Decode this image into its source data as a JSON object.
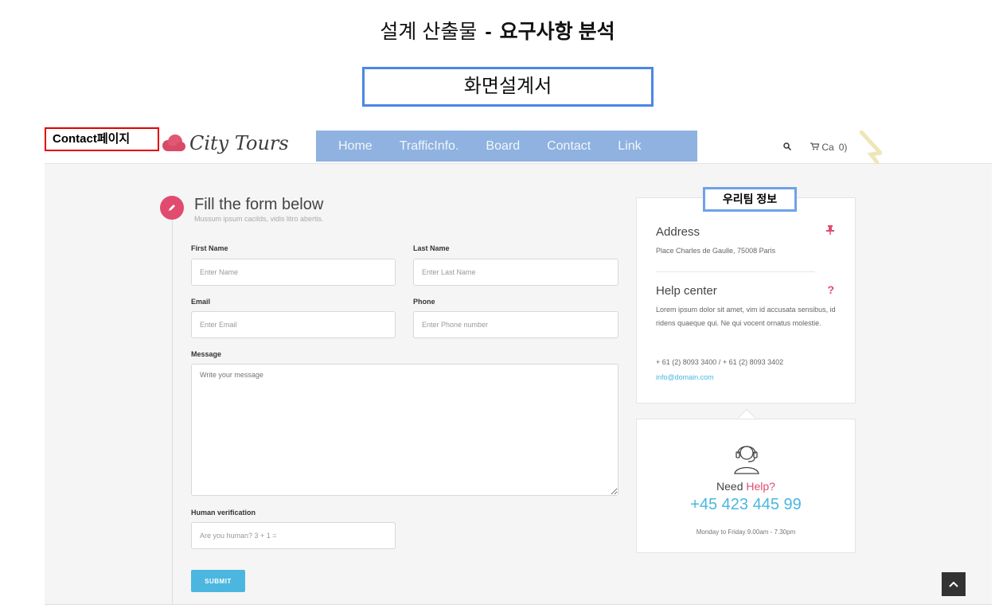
{
  "doc": {
    "title_part1": "설계 산출물",
    "title_sep": "-",
    "title_part2": "요구사항 분석",
    "subtitle": "화면설계서",
    "page_label": "Contact페이지",
    "team_label": "우리팀 정보"
  },
  "header": {
    "logo_text": "City Tours",
    "nav": [
      "Home",
      "TrafficInfo.",
      "Board",
      "Contact",
      "Link"
    ],
    "cart_label": "Ca",
    "cart_count": "0)"
  },
  "form": {
    "title": "Fill the form below",
    "subtitle": "Mussum ipsum cacilds, vidis litro abertis.",
    "first_name_label": "First Name",
    "first_name_placeholder": "Enter Name",
    "last_name_label": "Last Name",
    "last_name_placeholder": "Enter Last Name",
    "email_label": "Email",
    "email_placeholder": "Enter Email",
    "phone_label": "Phone",
    "phone_placeholder": "Enter Phone number",
    "message_label": "Message",
    "message_placeholder": "Write your message",
    "verification_label": "Human verification",
    "verification_placeholder": "Are you human? 3 + 1 =",
    "submit_label": "SUBMIT"
  },
  "info": {
    "address_title": "Address",
    "address_text": "Place Charles de Gaulle, 75008 Paris",
    "help_title": "Help center",
    "help_text": "Lorem ipsum dolor sit amet, vim id accusata sensibus, id ridens quaeque qui. Ne qui vocent ornatus molestie.",
    "phones": "+ 61 (2) 8093 3400 / + 61 (2) 8093 3402",
    "email": "info@domain.com",
    "address_icon": "pin-icon",
    "help_icon": "question-icon"
  },
  "help_box": {
    "need_text": "Need ",
    "need_accent": "Help?",
    "phone": "+45 423 445 99",
    "hours": "Monday to Friday 9.00am - 7.30pm"
  },
  "colors": {
    "accent": "#e04b6f",
    "link": "#4bb7e0",
    "nav_bg": "#8fb2e0",
    "label_border": "#e00000",
    "box_border": "#4a86e8"
  }
}
